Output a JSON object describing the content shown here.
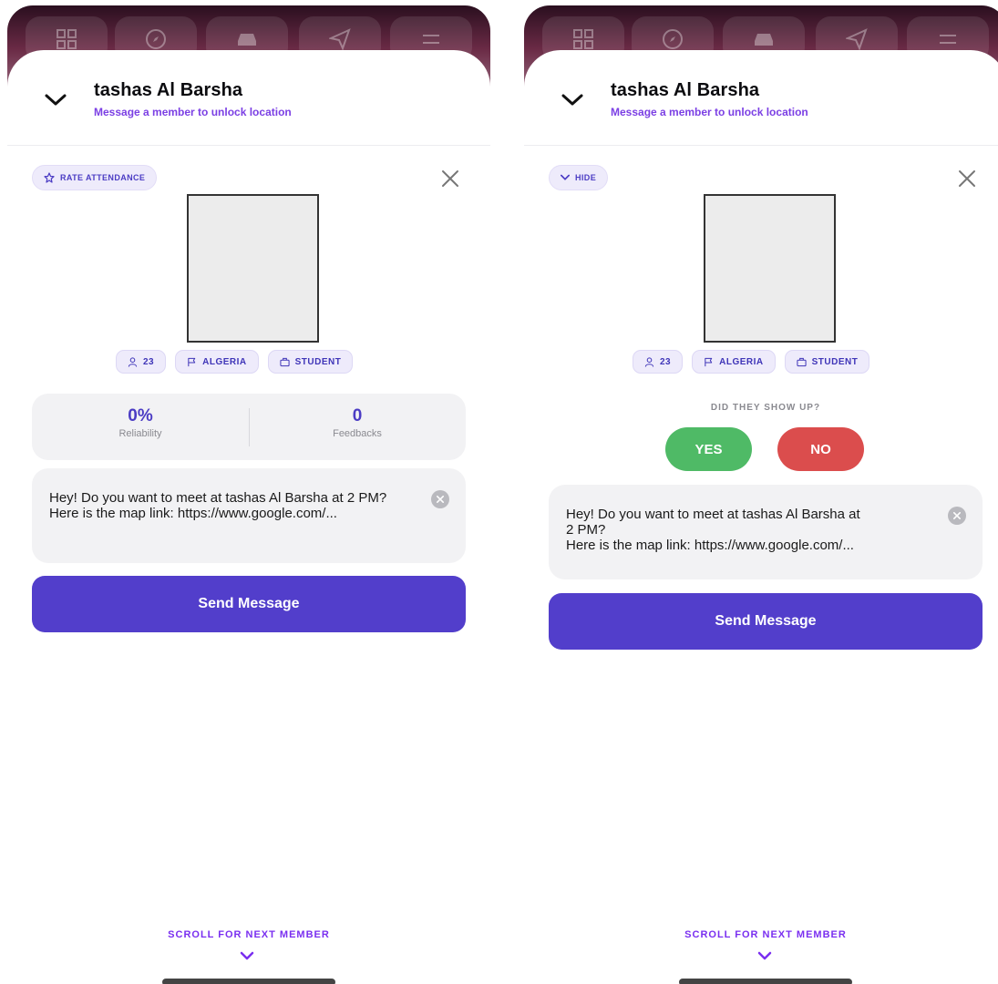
{
  "screens": [
    {
      "header": {
        "title": "tashas Al Barsha",
        "subtitle": "Message a member to unlock location"
      },
      "action_pill": {
        "label": "RATE ATTENDANCE",
        "icon": "star-icon"
      },
      "chips": [
        {
          "icon": "person-icon",
          "label": "23"
        },
        {
          "icon": "flag-icon",
          "label": "ALGERIA"
        },
        {
          "icon": "briefcase-icon",
          "label": "STUDENT"
        }
      ],
      "stats": [
        {
          "value": "0%",
          "label": "Reliability"
        },
        {
          "value": "0",
          "label": "Feedbacks"
        }
      ],
      "message": "Hey! Do you want to meet at tashas Al Barsha at 2 PM?\nHere is the map link: https://www.google.com/...",
      "send_label": "Send Message",
      "scroll_hint": "SCROLL FOR NEXT MEMBER"
    },
    {
      "header": {
        "title": "tashas Al Barsha",
        "subtitle": "Message a member to unlock location"
      },
      "action_pill": {
        "label": "HIDE",
        "icon": "chevron-down-icon"
      },
      "chips": [
        {
          "icon": "person-icon",
          "label": "23"
        },
        {
          "icon": "flag-icon",
          "label": "ALGERIA"
        },
        {
          "icon": "briefcase-icon",
          "label": "STUDENT"
        }
      ],
      "attendance": {
        "question": "DID THEY SHOW UP?",
        "yes_label": "YES",
        "no_label": "NO"
      },
      "message": "Hey! Do you want to meet at tashas Al Barsha at\n2 PM?\nHere is the map link: https://www.google.com/...",
      "send_label": "Send Message",
      "scroll_hint": "SCROLL FOR NEXT MEMBER"
    }
  ],
  "colors": {
    "accent": "#523ecb",
    "link": "#7b3fe4",
    "yes": "#4fba66",
    "no": "#db4d4d"
  }
}
